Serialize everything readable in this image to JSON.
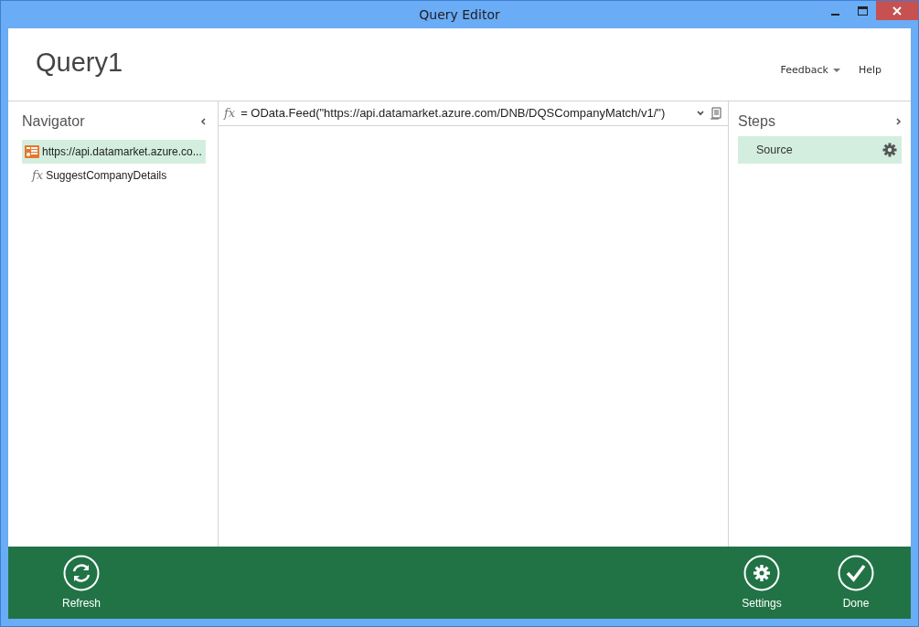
{
  "window": {
    "title": "Query Editor"
  },
  "header": {
    "title": "Query1",
    "links": [
      {
        "label": "Feedback",
        "dropdown": true
      },
      {
        "label": "Help",
        "dropdown": false
      }
    ]
  },
  "navigator": {
    "title": "Navigator",
    "items": [
      {
        "kind": "table",
        "label": "https://api.datamarket.azure.co...",
        "selected": true
      },
      {
        "kind": "function",
        "icon_text": "fx",
        "label": "SuggestCompanyDetails",
        "selected": false
      }
    ]
  },
  "formula_bar": {
    "icon_text": "fx",
    "formula": "= OData.Feed(\"https://api.datamarket.azure.com/DNB/DQSCompanyMatch/v1/\")"
  },
  "steps": {
    "title": "Steps",
    "items": [
      {
        "label": "Source",
        "selected": true
      }
    ]
  },
  "footer": {
    "buttons": [
      {
        "kind": "refresh",
        "label": "Refresh"
      },
      {
        "kind": "settings",
        "label": "Settings"
      },
      {
        "kind": "done",
        "label": "Done"
      }
    ]
  }
}
